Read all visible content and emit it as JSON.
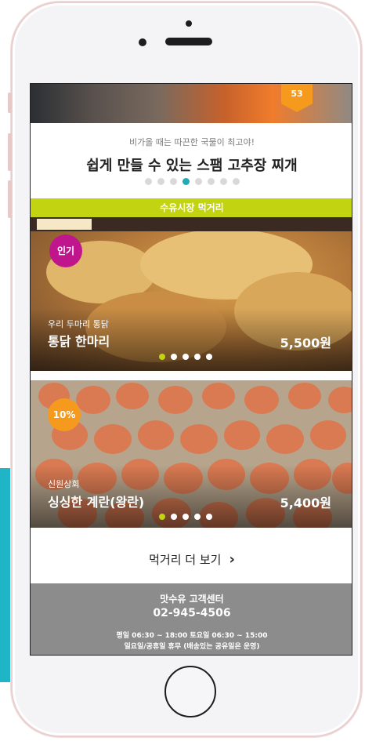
{
  "slider": {
    "badge": "53",
    "subtitle": "비가올 때는 따끈한 국물이 최고야!",
    "title": "쉽게 만들 수 있는 스팸 고추장 찌개",
    "dots_total": 8,
    "active_dot": 4
  },
  "section": {
    "title": "수유시장 먹거리"
  },
  "products": [
    {
      "badge": "인기",
      "shop": "우리 두마리 통닭",
      "name": "통닭 한마리",
      "price": "5,500원",
      "dots_total": 5,
      "active_dot": 1
    },
    {
      "badge": "10%",
      "shop": "신원상회",
      "name": "싱싱한 계란(왕란)",
      "price": "5,400원",
      "dots_total": 5,
      "active_dot": 1
    }
  ],
  "more": {
    "label": "먹거리 더 보기",
    "arrow": "›"
  },
  "footer": {
    "center_name": "맛수유 고객센터",
    "phone": "02-945-4506",
    "hours": "평일 06:30 ~ 18:00 토요일 06:30 ~ 15:00",
    "closed": "일요일/공휴일 휴무 (배송있는 공유일은 운영)"
  },
  "colors": {
    "accent_lime": "#c2d311",
    "accent_teal": "#20a9b6",
    "badge_pink": "#c0168d",
    "badge_orange": "#f59a1c",
    "footer_gray": "#8c8c8c"
  }
}
